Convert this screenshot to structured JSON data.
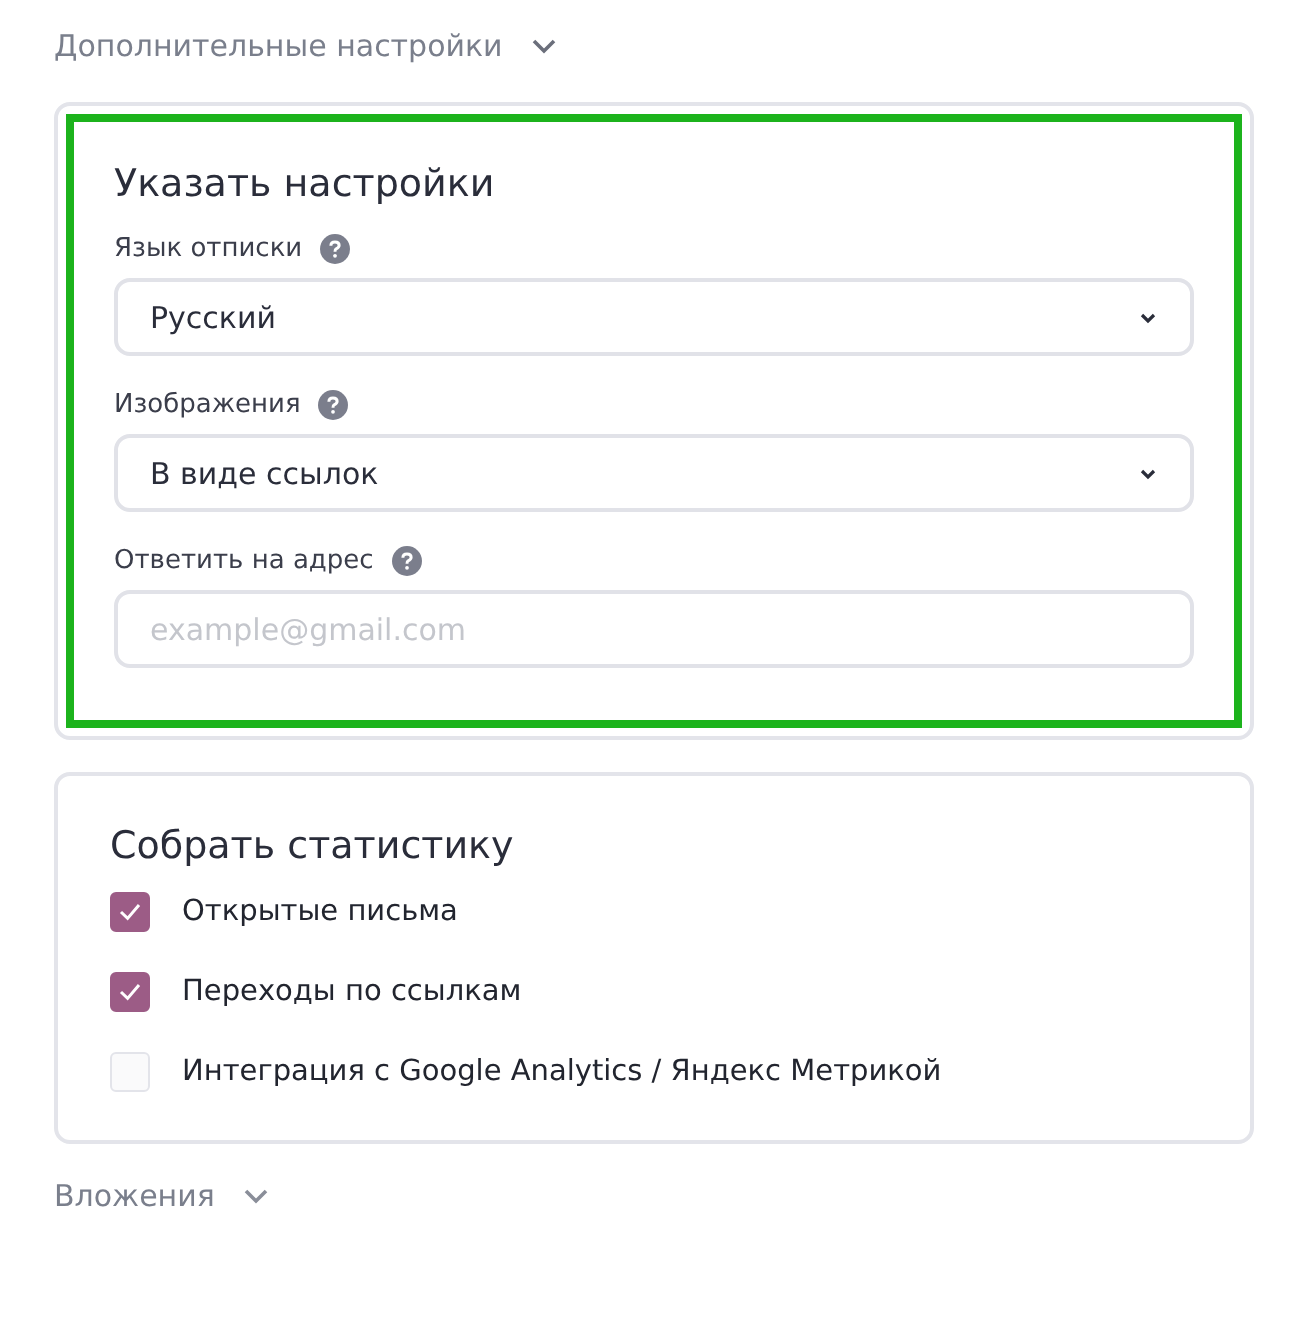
{
  "advanced_section": {
    "title": "Дополнительные настройки",
    "expanded": true
  },
  "settings_card": {
    "highlighted": true,
    "title": "Указать настройки",
    "fields": [
      {
        "kind": "select",
        "label": "Язык отписки",
        "value": "Русский"
      },
      {
        "kind": "select",
        "label": "Изображения",
        "value": "В виде ссылок"
      },
      {
        "kind": "input",
        "label": "Ответить на адрес",
        "placeholder": "example@gmail.com"
      }
    ]
  },
  "stats_card": {
    "title": "Собрать статистику",
    "options": [
      {
        "label": "Открытые письма",
        "checked": true
      },
      {
        "label": "Переходы по ссылкам",
        "checked": true
      },
      {
        "label": "Интеграция с Google Analytics / Яндекс Метрикой",
        "checked": false
      }
    ]
  },
  "attachments_section": {
    "title": "Вложения",
    "expanded": false
  }
}
